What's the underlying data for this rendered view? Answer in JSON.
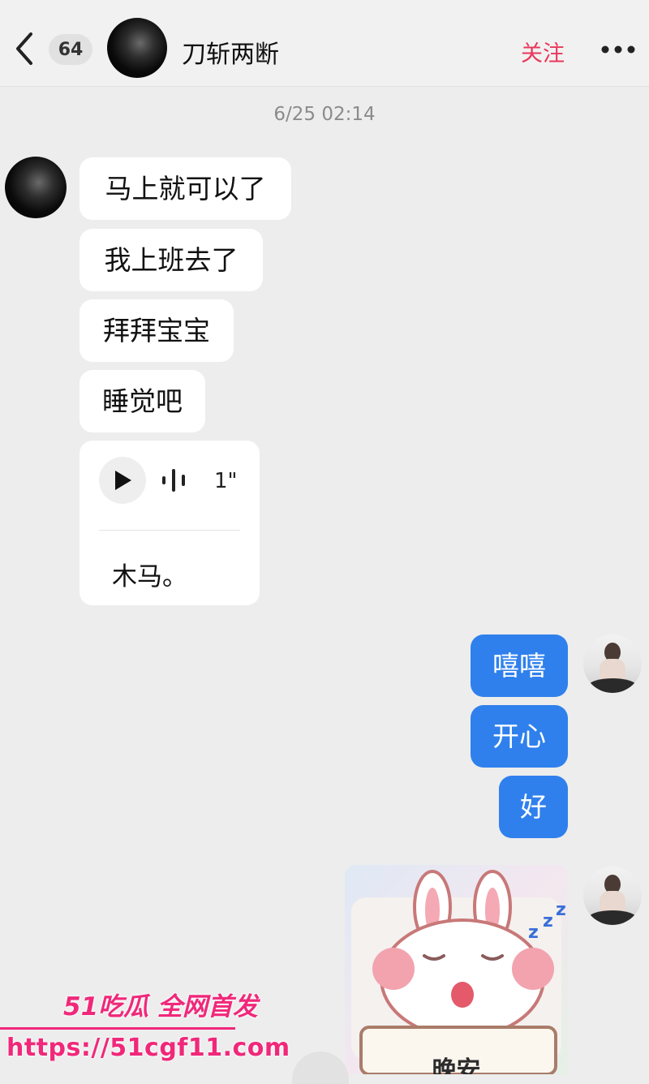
{
  "header": {
    "unread_count": "64",
    "contact_name": "刀斩两断",
    "follow_label": "关注"
  },
  "conversation": {
    "timestamp": "6/25 02:14",
    "incoming": [
      "马上就可以了",
      "我上班去了",
      "拜拜宝宝",
      "睡觉吧"
    ],
    "voice_message": {
      "duration": "1\"",
      "transcript": "木马。"
    },
    "outgoing": [
      "嘻嘻",
      "开心",
      "好"
    ],
    "sticker_caption": "晚安"
  },
  "watermark": {
    "brand": "51吃瓜 全网首发",
    "url": "https://51cgf11.com"
  },
  "colors": {
    "outgoing_bubble": "#2f80ed",
    "follow": "#e8385b",
    "watermark": "#f0287a"
  },
  "icons": [
    "back-icon",
    "more-icon",
    "play-icon",
    "voice-wave-icon"
  ]
}
